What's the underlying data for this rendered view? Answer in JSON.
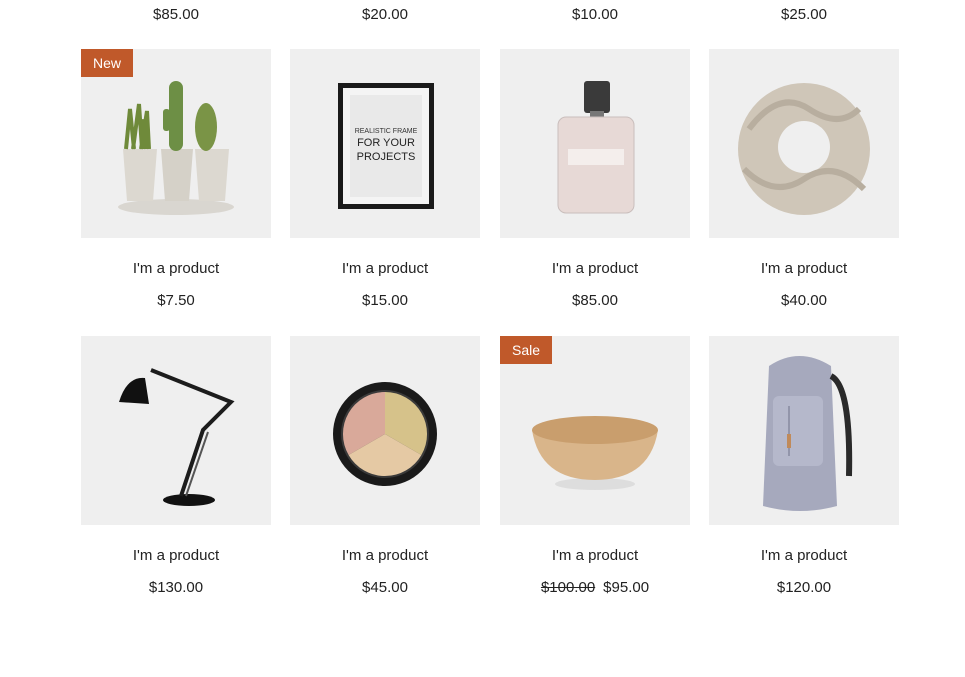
{
  "top_row_prices": [
    "$85.00",
    "$20.00",
    "$10.00",
    "$25.00"
  ],
  "products": [
    {
      "badge": "New",
      "title": "I'm a product",
      "price": "$7.50",
      "image": "cactus-plants"
    },
    {
      "badge": "",
      "title": "I'm a product",
      "price": "$15.00",
      "image": "picture-frame",
      "image_text": [
        "REALISTIC FRAME",
        "FOR YOUR",
        "PROJECTS"
      ]
    },
    {
      "badge": "",
      "title": "I'm a product",
      "price": "$85.00",
      "image": "perfume-bottle"
    },
    {
      "badge": "",
      "title": "I'm a product",
      "price": "$40.00",
      "image": "knit-scarf"
    },
    {
      "badge": "",
      "title": "I'm a product",
      "price": "$130.00",
      "image": "desk-lamp"
    },
    {
      "badge": "",
      "title": "I'm a product",
      "price": "$45.00",
      "image": "makeup-palette"
    },
    {
      "badge": "Sale",
      "title": "I'm a product",
      "price": "$95.00",
      "old_price": "$100.00",
      "image": "wooden-bowl"
    },
    {
      "badge": "",
      "title": "I'm a product",
      "price": "$120.00",
      "image": "backpack"
    }
  ],
  "colors": {
    "badge": "#c0592a",
    "thumb_bg": "#efefef"
  }
}
